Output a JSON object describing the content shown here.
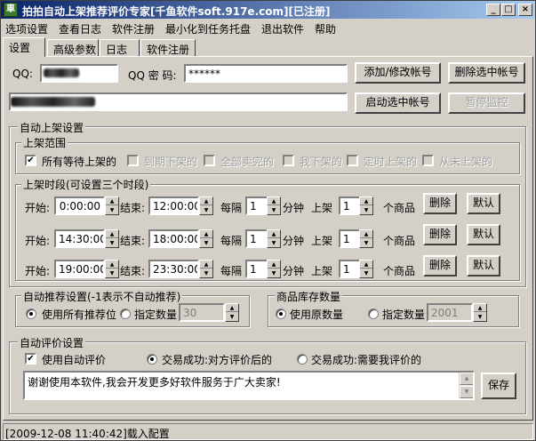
{
  "window": {
    "title": "拍拍自动上架推荐评价专家[千鱼软件soft.917e.com][已注册]",
    "app_icon_glyph": "車"
  },
  "window_buttons": {
    "minimize": "_",
    "maximize": "□",
    "close": "×"
  },
  "menu": [
    "选项设置",
    "查看日志",
    "软件注册",
    "最小化到任务托盘",
    "退出软件",
    "帮助"
  ],
  "tabs": [
    "设置",
    "高级参数",
    "日志",
    "软件注册"
  ],
  "account": {
    "qq_label": "QQ:",
    "pwd_label": "QQ 密 码:",
    "pwd_value": "******",
    "add_button": "添加/修改帐号",
    "delete_button": "删除选中帐号",
    "start_button": "启动选中帐号",
    "pause_button": "暂停监控"
  },
  "auto_shelf": {
    "title": "自动上架设置",
    "range": {
      "title": "上架范围",
      "options": [
        {
          "label": "所有等待上架的",
          "checked": true,
          "enabled": true
        },
        {
          "label": "到期下架的",
          "checked": false,
          "enabled": false
        },
        {
          "label": "全部卖完的",
          "checked": false,
          "enabled": false
        },
        {
          "label": "我下架的",
          "checked": false,
          "enabled": false
        },
        {
          "label": "定时上架的",
          "checked": false,
          "enabled": false
        },
        {
          "label": "从未上架的",
          "checked": false,
          "enabled": false
        }
      ]
    },
    "period": {
      "title": "上架时段(可设置三个时段)",
      "start_label": "开始:",
      "end_label": "结束:",
      "every_label": "每隔",
      "minute_label": "分钟",
      "shelf_label": "上架",
      "items_label": "个商品",
      "delete_button": "删除",
      "default_button": "默认",
      "rows": [
        {
          "start": "0:00:00",
          "end": "12:00:00",
          "interval": "1",
          "count": "1"
        },
        {
          "start": "14:30:00",
          "end": "18:00:00",
          "interval": "1",
          "count": "1"
        },
        {
          "start": "19:00:00",
          "end": "23:30:00",
          "interval": "1",
          "count": "1"
        }
      ]
    }
  },
  "recommend": {
    "title": "自动推荐设置(-1表示不自动推荐)",
    "opt_all": "使用所有推荐位",
    "opt_fixed": "指定数量",
    "fixed_value": "30"
  },
  "stock": {
    "title": "商品库存数量",
    "opt_original": "使用原数量",
    "opt_fixed": "指定数量",
    "fixed_value": "2001"
  },
  "auto_rate": {
    "title": "自动评价设置",
    "use_label": "使用自动评价",
    "opt_after_peer": "交易成功:对方评价后的",
    "opt_need_me": "交易成功:需要我评价的",
    "message": "谢谢使用本软件,我会开发更多好软件服务于广大卖家!",
    "save_button": "保存"
  },
  "status": {
    "text": "[2009-12-08 11:40:42]载入配置"
  },
  "icons": {
    "check": "✔",
    "spin_up": "▲",
    "spin_down": "▼"
  }
}
